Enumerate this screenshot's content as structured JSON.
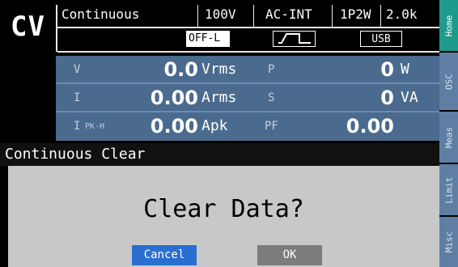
{
  "header": {
    "mode": "CV",
    "title": "Continuous",
    "voltage_range": "100V",
    "source": "AC-INT",
    "wiring": "1P2W",
    "current_range": "2.0k",
    "output_state": "OFF-L",
    "interface": "USB",
    "waveform_icon": "square-wave-icon"
  },
  "measurements": {
    "rows": [
      {
        "left_label": "V",
        "left_sub": "",
        "left_value": "0.0",
        "left_unit": "Vrms",
        "right_label": "P",
        "right_value": "0",
        "right_unit": "W"
      },
      {
        "left_label": "I",
        "left_sub": "",
        "left_value": "0.00",
        "left_unit": "Arms",
        "right_label": "S",
        "right_value": "0",
        "right_unit": "VA"
      },
      {
        "left_label": "I",
        "left_sub": "PK-H",
        "left_value": "0.00",
        "left_unit": "Apk",
        "right_label": "PF",
        "right_value": "0.00",
        "right_unit": ""
      }
    ]
  },
  "tabs": [
    "Home",
    "OSC",
    "Meas",
    "Limit",
    "Misc"
  ],
  "dialog": {
    "title": "Continuous Clear",
    "message": "Clear Data?",
    "cancel_label": "Cancel",
    "ok_label": "OK"
  },
  "colors": {
    "panel": "#4a6a8e",
    "active_tab": "#1f9a8b",
    "cancel": "#2a6fd0",
    "dialog_bg": "#c8c8c8"
  }
}
